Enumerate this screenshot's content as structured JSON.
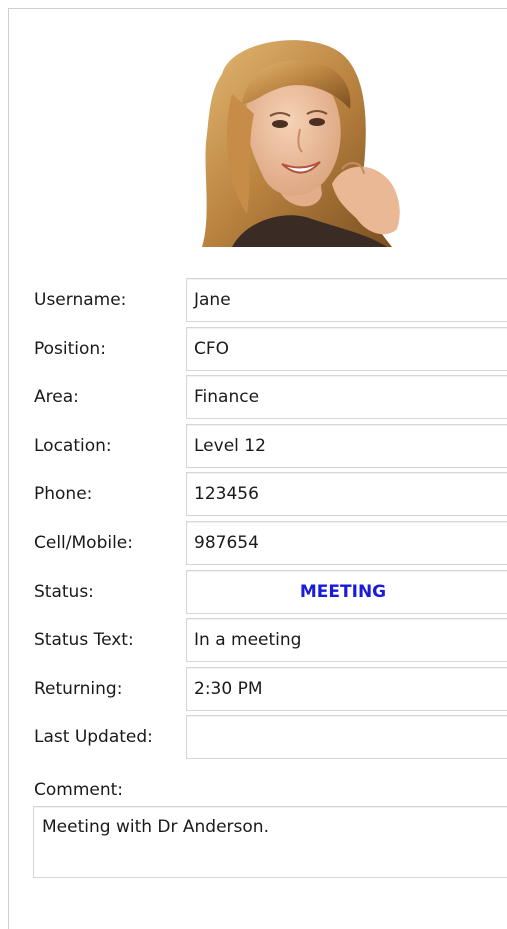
{
  "profile": {
    "photo_icon": "user-photo",
    "fields": [
      {
        "label": "Username:",
        "value": "Jane"
      },
      {
        "label": "Position:",
        "value": "CFO"
      },
      {
        "label": "Area:",
        "value": "Finance"
      },
      {
        "label": "Location:",
        "value": "Level 12"
      },
      {
        "label": "Phone:",
        "value": "123456"
      },
      {
        "label": "Cell/Mobile:",
        "value": "987654"
      },
      {
        "label": "Status:",
        "value": "MEETING"
      },
      {
        "label": "Status Text:",
        "value": "In a meeting"
      },
      {
        "label": "Returning:",
        "value": "2:30 PM"
      },
      {
        "label": "Last Updated:",
        "value": ""
      }
    ],
    "status_color": "#1a1adb",
    "comment_label": "Comment:",
    "comment_value": "Meeting with Dr Anderson."
  }
}
